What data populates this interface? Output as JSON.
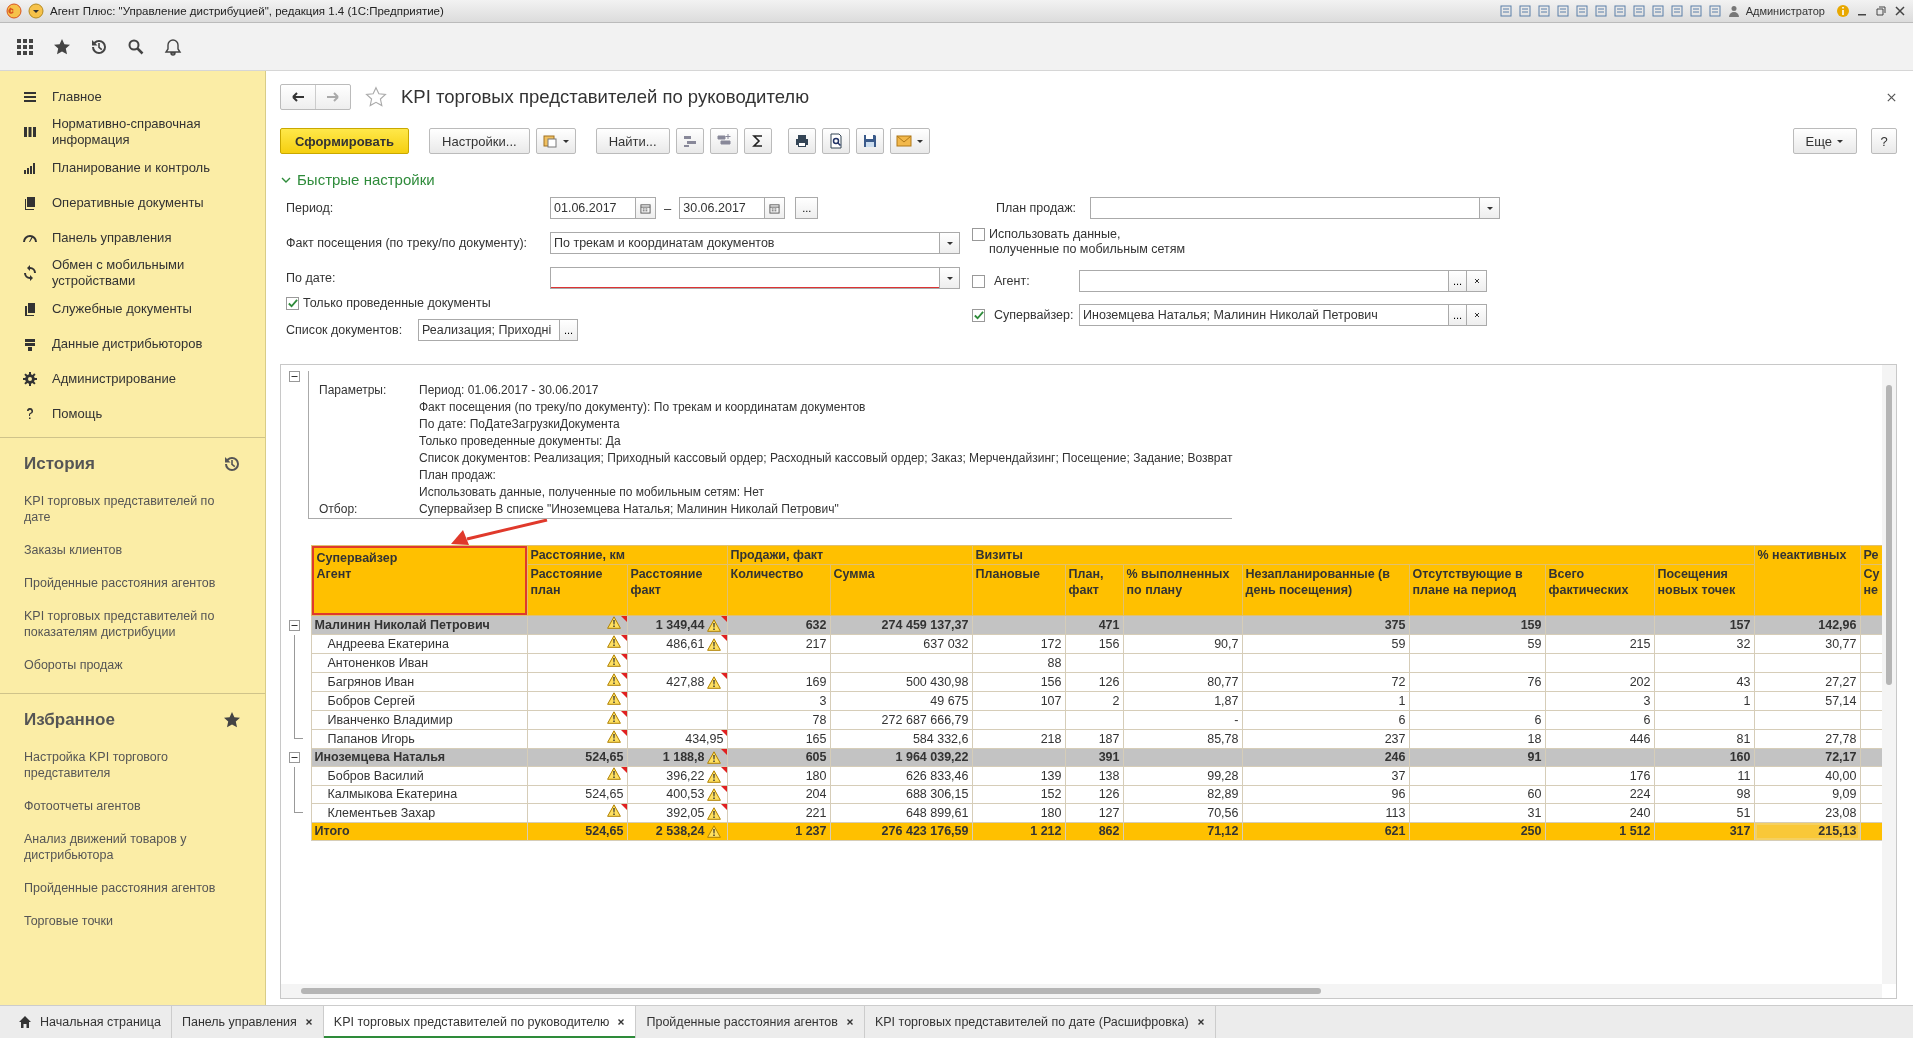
{
  "window": {
    "title": "Агент Плюс: \"Управление дистрибуцией\", редакция 1.4  (1С:Предприятие)",
    "user": "Администратор"
  },
  "sidebar": {
    "menu": [
      "Главное",
      "Нормативно-справочная информация",
      "Планирование и контроль",
      "Оперативные документы",
      "Панель управления",
      "Обмен с мобильными устройствами",
      "Служебные документы",
      "Данные дистрибьюторов",
      "Администрирование",
      "Помощь"
    ],
    "history": {
      "title": "История",
      "items": [
        "KPI торговых представителей по дате",
        "Заказы клиентов",
        "Пройденные расстояния агентов",
        "KPI торговых представителей по показателям дистрибуции",
        "Обороты продаж"
      ]
    },
    "favorites": {
      "title": "Избранное",
      "items": [
        "Настройка KPI торгового представителя",
        "Фотоотчеты агентов",
        "Анализ движений товаров у дистрибьютора",
        "Пройденные расстояния агентов",
        "Торговые точки"
      ]
    }
  },
  "page": {
    "title": "KPI торговых представителей по руководителю",
    "toolbar": {
      "generate": "Сформировать",
      "settings": "Настройки...",
      "find": "Найти...",
      "more": "Еще",
      "help": "?"
    },
    "quick_settings": {
      "title": "Быстрые настройки",
      "expanded": true,
      "period": {
        "label": "Период:",
        "from": "01.06.2017",
        "dash": "–",
        "to": "30.06.2017",
        "pick": "..."
      },
      "visit_fact": {
        "label": "Факт посещения (по треку/по документу):",
        "value": "По трекам и координатам документов"
      },
      "by_date": {
        "label": "По дате:"
      },
      "posted_only": {
        "label": "Только проведенные документы",
        "checked": true
      },
      "documents": {
        "label": "Список документов:",
        "value": "Реализация; Приходні",
        "pick": "..."
      },
      "sales_plan": {
        "label": "План продаж:"
      },
      "mobile_data": {
        "label": "Использовать данные,\nполученные по мобильным сетям",
        "checked": false
      },
      "agent": {
        "label": "Агент:",
        "checked": false,
        "pick": "..."
      },
      "supervisor": {
        "label": "Супервайзер:",
        "checked": true,
        "value": "Иноземцева Наталья; Малинин Николай Петрович",
        "pick": "..."
      }
    }
  },
  "report": {
    "parameters": [
      {
        "label": "Параметры:",
        "lines": [
          "Период: 01.06.2017 - 30.06.2017",
          "Факт посещения (по треку/по документу): По трекам и координатам документов",
          "По дате: ПоДатеЗагрузкиДокумента",
          "Только проведенные документы: Да",
          "Список документов: Реализация; Приходный кассовый ордер; Расходный кассовый ордер; Заказ; Мерчендайзинг; Посещение; Задание; Возврат",
          "План продаж:",
          "Использовать данные, полученные по мобильным сетям: Нет"
        ]
      },
      {
        "label": "Отбор:",
        "lines": [
          "Супервайзер В списке \"Иноземцева Наталья; Малинин Николай Петрович\""
        ]
      }
    ],
    "table": {
      "first_header": [
        "Супервайзер",
        "Агент"
      ],
      "column_groups": [
        {
          "kind": "group",
          "label": "Расстояние, км",
          "columns": [
            "Расстояние план",
            "Расстояние факт"
          ]
        },
        {
          "kind": "group",
          "label": "Продажи, факт",
          "columns": [
            "Количество",
            "Сумма"
          ]
        },
        {
          "kind": "group",
          "label": "Визиты",
          "columns": [
            "Плановые",
            "План, факт",
            "% выполненных по плану",
            "Незапланированные (в день посещения)",
            "Отсутствующие в плане на период",
            "Всего фактических",
            "Посещения новых точек"
          ]
        },
        {
          "kind": "single",
          "label": "% неактивных"
        },
        {
          "kind": "group",
          "label": "Ре",
          "columns": [
            "Су не"
          ]
        }
      ],
      "groups": [
        {
          "name": "Малинин Николай Петрович",
          "expanded": true,
          "plan_warning": true,
          "fact_warning": true,
          "fact_note": true,
          "cells": [
            "",
            "1 349,44",
            "632",
            "274 459 137,37",
            "",
            "471",
            "",
            "375",
            "159",
            "",
            "157",
            "142,96"
          ],
          "children": [
            {
              "name": "Андреева Екатерина",
              "plan_warning": true,
              "fact_warning": true,
              "fact_note": true,
              "cells": [
                "",
                "486,61",
                "217",
                "637 032",
                "172",
                "156",
                "90,7",
                "59",
                "59",
                "215",
                "32",
                "30,77"
              ]
            },
            {
              "name": "Антоненков Иван",
              "plan_warning": true,
              "fact_warning": false,
              "fact_note": false,
              "cells": [
                "",
                "",
                "",
                "",
                "88",
                "",
                "",
                "",
                "",
                "",
                "",
                ""
              ]
            },
            {
              "name": "Багрянов Иван",
              "plan_warning": true,
              "fact_warning": true,
              "fact_note": true,
              "cells": [
                "",
                "427,88",
                "169",
                "500 430,98",
                "156",
                "126",
                "80,77",
                "72",
                "76",
                "202",
                "43",
                "27,27"
              ]
            },
            {
              "name": "Бобров Сергей",
              "plan_warning": true,
              "fact_warning": false,
              "fact_note": false,
              "cells": [
                "",
                "",
                "3",
                "49 675",
                "107",
                "2",
                "1,87",
                "1",
                "",
                "3",
                "1",
                "57,14"
              ]
            },
            {
              "name": "Иванченко Владимир",
              "plan_warning": true,
              "fact_warning": false,
              "fact_note": false,
              "cells": [
                "",
                "",
                "78",
                "272 687 666,79",
                "",
                "",
                "-",
                "6",
                "6",
                "6",
                "",
                ""
              ]
            },
            {
              "name": "Папанов Игорь",
              "plan_warning": true,
              "fact_warning": false,
              "fact_note": true,
              "cells": [
                "",
                "434,95",
                "165",
                "584 332,6",
                "218",
                "187",
                "85,78",
                "237",
                "18",
                "446",
                "81",
                "27,78"
              ]
            }
          ]
        },
        {
          "name": "Иноземцева Наталья",
          "expanded": true,
          "plan_warning": false,
          "fact_warning": true,
          "fact_note": true,
          "cells": [
            "524,65",
            "1 188,8",
            "605",
            "1 964 039,22",
            "",
            "391",
            "",
            "246",
            "91",
            "",
            "160",
            "72,17"
          ],
          "children": [
            {
              "name": "Бобров Василий",
              "plan_warning": true,
              "fact_warning": true,
              "fact_note": true,
              "cells": [
                "",
                "396,22",
                "180",
                "626 833,46",
                "139",
                "138",
                "99,28",
                "37",
                "",
                "176",
                "11",
                "40,00"
              ]
            },
            {
              "name": "Калмыкова Екатерина",
              "plan_warning": false,
              "fact_warning": true,
              "fact_note": true,
              "cells": [
                "524,65",
                "400,53",
                "204",
                "688 306,15",
                "152",
                "126",
                "82,89",
                "96",
                "60",
                "224",
                "98",
                "9,09"
              ]
            },
            {
              "name": "Клементьев Захар",
              "plan_warning": true,
              "fact_warning": true,
              "fact_note": true,
              "cells": [
                "",
                "392,05",
                "221",
                "648 899,61",
                "180",
                "127",
                "70,56",
                "113",
                "31",
                "240",
                "51",
                "23,08"
              ]
            }
          ]
        }
      ],
      "total": {
        "name": "Итого",
        "plan_warning": false,
        "fact_warning": true,
        "fact_note": false,
        "cells": [
          "524,65",
          "2 538,24",
          "1 237",
          "276 423 176,59",
          "1 212",
          "862",
          "71,12",
          "621",
          "250",
          "1 512",
          "317",
          "215,13"
        ]
      }
    }
  },
  "tabs": [
    {
      "label": "Начальная страница",
      "kind": "home",
      "selected": false
    },
    {
      "label": "Панель управления",
      "kind": "closable",
      "selected": false
    },
    {
      "label": "KPI торговых представителей по руководителю",
      "kind": "closable",
      "selected": true
    },
    {
      "label": "Пройденные расстояния агентов",
      "kind": "closable",
      "selected": false
    },
    {
      "label": "KPI торговых представителей по дате (Расшифровка)",
      "kind": "closable",
      "selected": false
    }
  ]
}
